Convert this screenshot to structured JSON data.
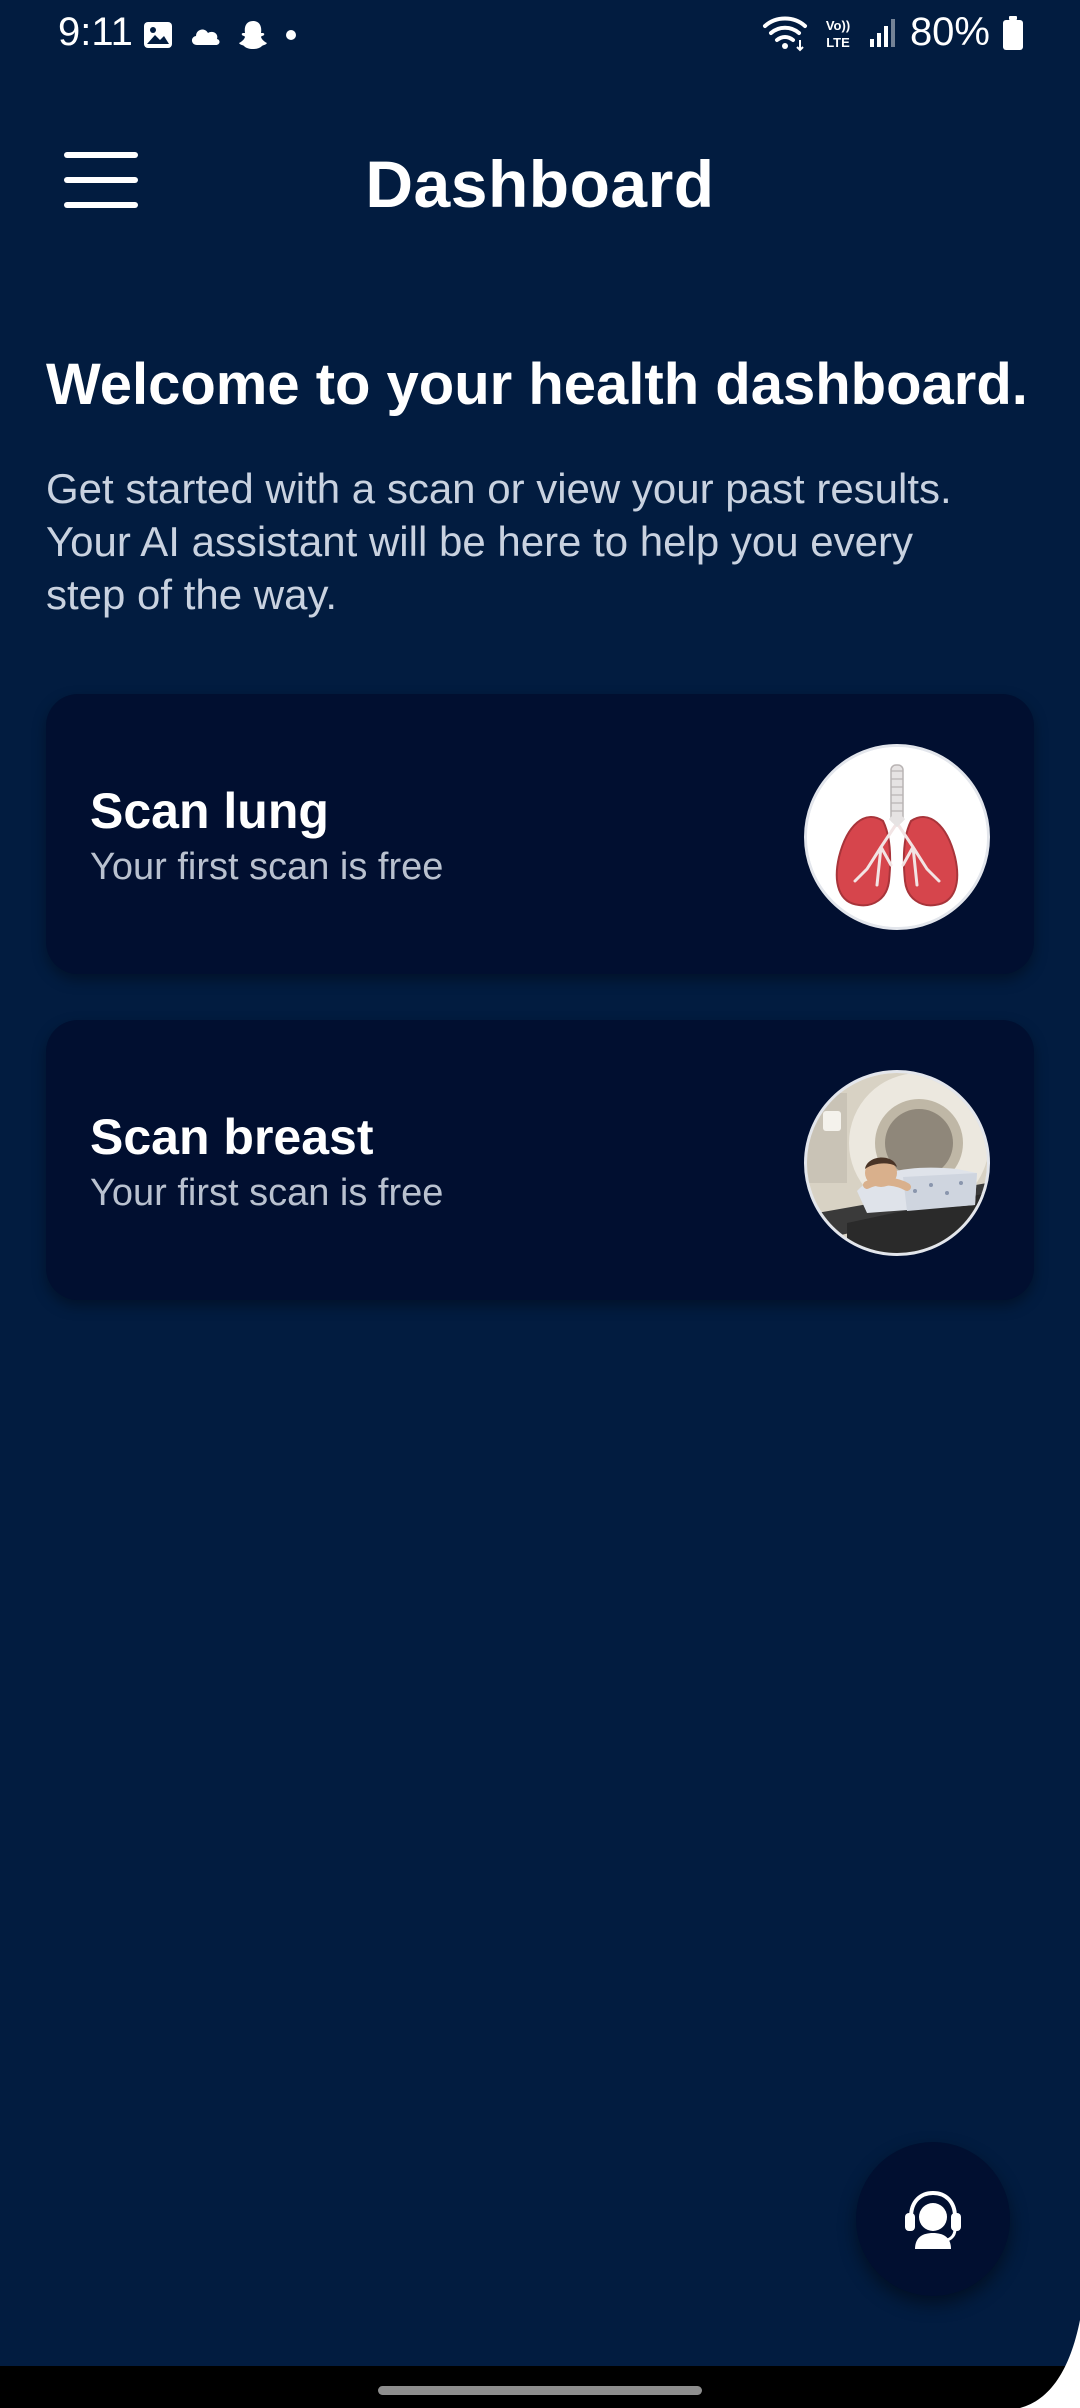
{
  "status_bar": {
    "time": "9:11",
    "battery": "80%",
    "network": "LTE",
    "left_icons": [
      "gallery-icon",
      "cloud-icon",
      "snapchat-icon",
      "dot-icon"
    ],
    "right_icons": [
      "wifi-icon",
      "volte-icon",
      "signal-icon",
      "battery-icon"
    ]
  },
  "header": {
    "title": "Dashboard",
    "menu_icon": "hamburger-menu-icon"
  },
  "welcome": {
    "title": "Welcome to your health dashboard.",
    "subtitle_lines": [
      "Get started with a scan or view your past results.",
      "Your AI assistant will be here to help you every",
      "step of the way."
    ]
  },
  "cards": [
    {
      "title": "Scan lung",
      "subtitle": "Your first scan is free",
      "image": "lungs-illustration"
    },
    {
      "title": "Scan breast",
      "subtitle": "Your first scan is free",
      "image": "patient-scanner-photo"
    }
  ],
  "fab": {
    "icon": "ai-assistant-headset-icon"
  },
  "colors": {
    "background": "#021c40",
    "card": "#010f30",
    "text_primary": "#ffffff",
    "text_secondary": "#b9c1cf"
  }
}
